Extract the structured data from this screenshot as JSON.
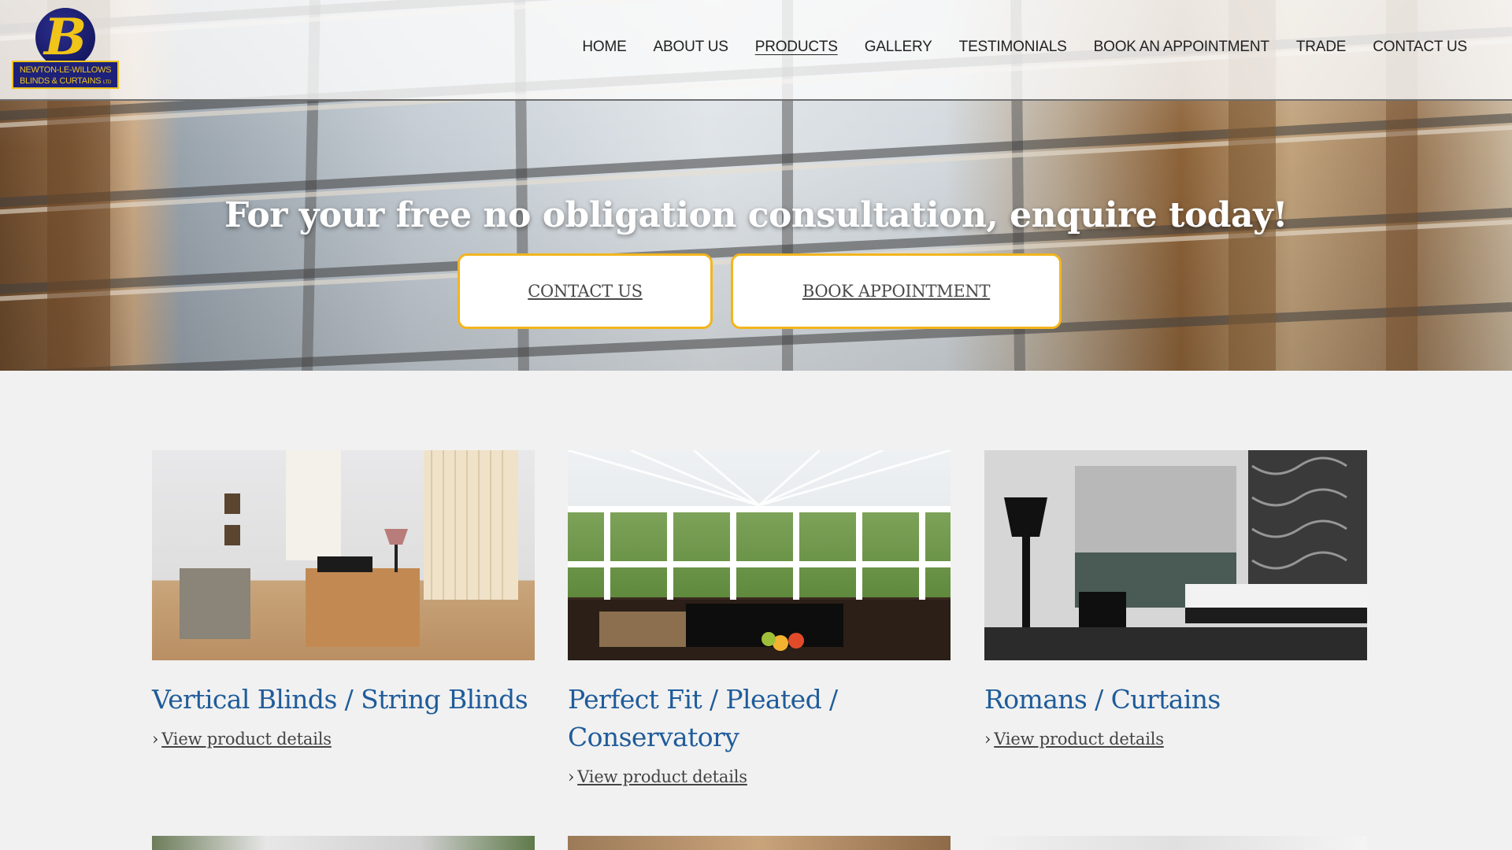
{
  "brand": {
    "logo_letter": "B",
    "logo_line1": "NEWTON-LE-WILLOWS",
    "logo_line2": "BLINDS & CURTAINS",
    "logo_suffix": "LTD",
    "primary_color": "#1d2179",
    "accent_color": "#f0c419"
  },
  "nav": {
    "items": [
      {
        "label": "HOME"
      },
      {
        "label": "ABOUT US"
      },
      {
        "label": "PRODUCTS",
        "active": true
      },
      {
        "label": "GALLERY"
      },
      {
        "label": "TESTIMONIALS"
      },
      {
        "label": "BOOK AN APPOINTMENT"
      },
      {
        "label": "TRADE"
      },
      {
        "label": "CONTACT US"
      }
    ]
  },
  "hero": {
    "heading": "For your free no obligation consultation, enquire today!",
    "contact_button": "CONTACT US",
    "book_button": "BOOK APPOINTMENT",
    "button_border_color": "#f3b51d"
  },
  "products": [
    {
      "title": "Vertical Blinds / String Blinds",
      "link_label": "View product details",
      "link_icon": "chevron-right-icon"
    },
    {
      "title": "Perfect Fit / Pleated / Conservatory",
      "link_label": "View product details",
      "link_icon": "chevron-right-icon"
    },
    {
      "title": "Romans / Curtains",
      "link_label": "View product details",
      "link_icon": "chevron-right-icon"
    }
  ],
  "colors": {
    "product_title": "#1f5c9a",
    "page_background": "#f1f1f1"
  }
}
